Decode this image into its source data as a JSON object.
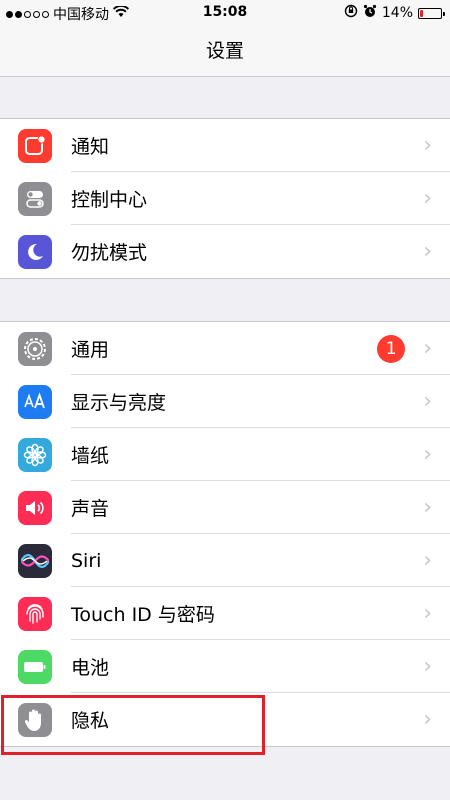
{
  "status": {
    "carrier": "中国移动",
    "time": "15:08",
    "battery_text": "14%",
    "battery_level": 0.14
  },
  "nav": {
    "title": "设置"
  },
  "group1": [
    {
      "label": "通知",
      "icon": "notifications-icon",
      "color": "#ff3b30"
    },
    {
      "label": "控制中心",
      "icon": "control-center-icon",
      "color": "#8e8e93"
    },
    {
      "label": "勿扰模式",
      "icon": "moon-icon",
      "color": "#5856d6"
    }
  ],
  "group2": [
    {
      "label": "通用",
      "icon": "gear-icon",
      "color": "#8e8e93",
      "badge": "1"
    },
    {
      "label": "显示与亮度",
      "icon": "display-brightness-icon",
      "color": "#1e7cf2"
    },
    {
      "label": "墙纸",
      "icon": "wallpaper-icon",
      "color": "#34aadc"
    },
    {
      "label": "声音",
      "icon": "speaker-icon",
      "color": "#ff2d55"
    },
    {
      "label": "Siri",
      "icon": "siri-icon",
      "color": "#2b2a3a"
    },
    {
      "label": "Touch ID 与密码",
      "icon": "fingerprint-icon",
      "color": "#ff2d55"
    },
    {
      "label": "电池",
      "icon": "battery-icon",
      "color": "#4cd964"
    },
    {
      "label": "隐私",
      "icon": "hand-icon",
      "color": "#8e8e93"
    }
  ],
  "colors": {
    "accent_highlight": "#e1212a"
  }
}
